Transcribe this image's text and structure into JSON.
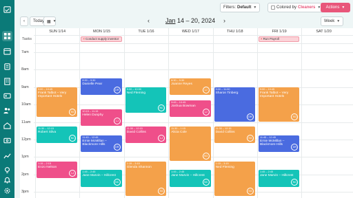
{
  "sidebar": {
    "icons": [
      "calendar-check-icon",
      "grid-icon",
      "calendar-icon",
      "clipboard-icon",
      "building-icon",
      "id-card-icon",
      "users-icon",
      "home-icon",
      "dollar-icon",
      "chart-icon",
      "lightbulb-icon",
      "bell-icon",
      "settings-icon"
    ]
  },
  "toolbar": {
    "filters_label": "Filters:",
    "filters_value": "Default",
    "colored_label": "Colored by",
    "colored_value": "Cleaners",
    "actions_label": "Actions"
  },
  "nav": {
    "today_label": "Today",
    "title_month": "Jan",
    "title_rest": "14 – 20, 2024",
    "view_label": "Week"
  },
  "days": [
    "SUN 1/14",
    "MON 1/15",
    "TUE 1/16",
    "WED 1/17",
    "THU 1/18",
    "FRI 1/19",
    "SAT 1/20"
  ],
  "tasks_label": "Tasks",
  "times": [
    "7am",
    "8am",
    "9am",
    "10am",
    "11am",
    "12pm",
    "1pm",
    "2pm",
    "3pm"
  ],
  "tasks": [
    {
      "day": 1,
      "label": "Conduct supply inventor"
    },
    {
      "day": 5,
      "label": "Run Payroll"
    }
  ],
  "events": [
    {
      "day": 0,
      "start": 9.0,
      "end": 10.75,
      "color": "orange",
      "time": "9:00 – 10:45",
      "name": "Frank Talbot – Very Important Hotels",
      "avatar": "SG"
    },
    {
      "day": 0,
      "start": 11.25,
      "end": 12.25,
      "color": "teal",
      "time": "11:30 – 12:15",
      "name": "Robert Silva",
      "avatar": "NC"
    },
    {
      "day": 0,
      "start": 13.25,
      "end": 14.25,
      "color": "pink",
      "time": "1:15 – 2:15",
      "name": "Enzo Nelson",
      "avatar": "LJ"
    },
    {
      "day": 1,
      "start": 8.5,
      "end": 9.5,
      "color": "blue",
      "time": "8:30 – 9:30",
      "name": "Danielle Pear",
      "avatar": "DR"
    },
    {
      "day": 1,
      "start": 10.25,
      "end": 11.25,
      "color": "pink",
      "time": "10:15 – 11:15",
      "name": "Helen Dunphy",
      "avatar": "LJ"
    },
    {
      "day": 1,
      "start": 11.75,
      "end": 12.75,
      "color": "blue",
      "time": "11:45 – 12:45",
      "name": "Ernie McMillan – Blackmore Hills",
      "avatar": "DR"
    },
    {
      "day": 1,
      "start": 13.75,
      "end": 14.75,
      "color": "teal",
      "time": "1:45 – 2:45",
      "name": "Jane Marvin – Hillcrest",
      "avatar": "NC"
    },
    {
      "day": 2,
      "start": 9.0,
      "end": 10.5,
      "color": "teal",
      "time": "9:00 – 10:30",
      "name": "Ned Fleming",
      "avatar": "NC"
    },
    {
      "day": 2,
      "start": 11.25,
      "end": 12.25,
      "color": "pink",
      "time": "11:30 – 12:15",
      "name": "David Collins",
      "avatar": "LJ"
    },
    {
      "day": 2,
      "start": 13.25,
      "end": 15.25,
      "color": "orange",
      "time": "1:15 – 3:15",
      "name": "Glenda Shannon",
      "avatar": "SG"
    },
    {
      "day": 3,
      "start": 8.5,
      "end": 9.5,
      "color": "orange",
      "time": "8:30 – 9:30",
      "name": "Joanne Reyes",
      "avatar": "LJ"
    },
    {
      "day": 3,
      "start": 9.75,
      "end": 10.75,
      "color": "pink",
      "time": "9:45 – 10:45",
      "name": "Joshua Bowman",
      "avatar": "LJ"
    },
    {
      "day": 3,
      "start": 11.25,
      "end": 13.25,
      "color": "orange",
      "time": "11:30 – 1:15",
      "name": "Alicia Cole",
      "avatar": "SG"
    },
    {
      "day": 3,
      "start": 13.75,
      "end": 14.75,
      "color": "teal",
      "time": "1:45 – 2:45",
      "name": "Jane Marvin – Hillcrest",
      "avatar": "NC"
    },
    {
      "day": 4,
      "start": 9.0,
      "end": 11.0,
      "color": "blue",
      "time": "9:00 – 11:00",
      "name": "Sharon Tinberg",
      "avatar": "DR"
    },
    {
      "day": 4,
      "start": 11.25,
      "end": 12.25,
      "color": "orange",
      "time": "11:30 – 12:15",
      "name": "David Collins",
      "avatar": "SG"
    },
    {
      "day": 4,
      "start": 13.25,
      "end": 15.25,
      "color": "orange",
      "time": "1:15 – 3:15",
      "name": "Ned Fleming",
      "avatar": "SG"
    },
    {
      "day": 5,
      "start": 9.0,
      "end": 11.0,
      "color": "orange",
      "time": "9:00 – 10:45",
      "name": "Frank Talbot – Very Important Hotels",
      "avatar": "SG"
    },
    {
      "day": 5,
      "start": 11.75,
      "end": 12.75,
      "color": "blue",
      "time": "11:45 – 12:45",
      "name": "Ernie McMillan – Blackmore Hills",
      "avatar": "DR"
    },
    {
      "day": 5,
      "start": 13.75,
      "end": 14.75,
      "color": "teal",
      "time": "1:45 – 2:45",
      "name": "Jane Marvin – Hillcrest",
      "avatar": "NC"
    }
  ]
}
